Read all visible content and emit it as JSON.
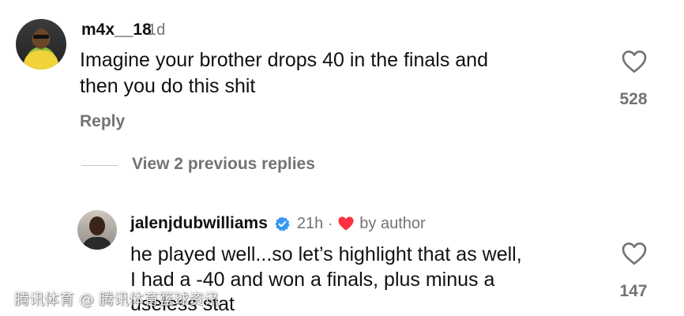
{
  "comment": {
    "username": "m4x__18",
    "time": "1d",
    "text_line1": "Imagine your brother drops 40 in the finals and",
    "text_line2": "then you do this shit",
    "likes": "528",
    "reply_label": "Reply"
  },
  "thread": {
    "view_replies_label": "View 2 previous replies"
  },
  "reply": {
    "username": "jalenjdubwilliams",
    "time": "21h",
    "separator": "·",
    "by_author_label": "by author",
    "text_line1": "he played well...so let’s highlight that as well,",
    "text_line2": "I had a -40 and won a finals, plus minus a",
    "text_line3": "useless stat",
    "likes": "147"
  },
  "watermark": "腾讯体育 @ 腾讯体育篮球资讯",
  "colors": {
    "text": "#111111",
    "muted": "#737373",
    "verified": "#3897f0",
    "heart": "#ff3040"
  },
  "icons": {
    "like": "heart-outline-icon",
    "verified": "verified-badge-icon",
    "liked_by_author": "heart-filled-icon"
  }
}
